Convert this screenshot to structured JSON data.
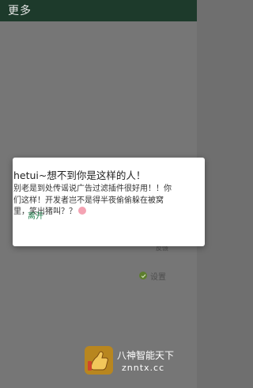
{
  "app_bar": {
    "title": "更多",
    "background": "#1d3a2b"
  },
  "background_items": {
    "partial_text": "反馈",
    "settings_label": "设置"
  },
  "dialog": {
    "title": "hetui~想不到你是这样的人！",
    "message": "别老是到处传谣说广告过滤插件很好用！！你们这样！开发者岂不是得半夜偷偷躲在被窝里，笑出猪叫？？",
    "button_label": "离开",
    "accent": "#1e7d4a"
  },
  "watermark": {
    "line1": "八神智能天下",
    "line2": "znntx.cc"
  }
}
